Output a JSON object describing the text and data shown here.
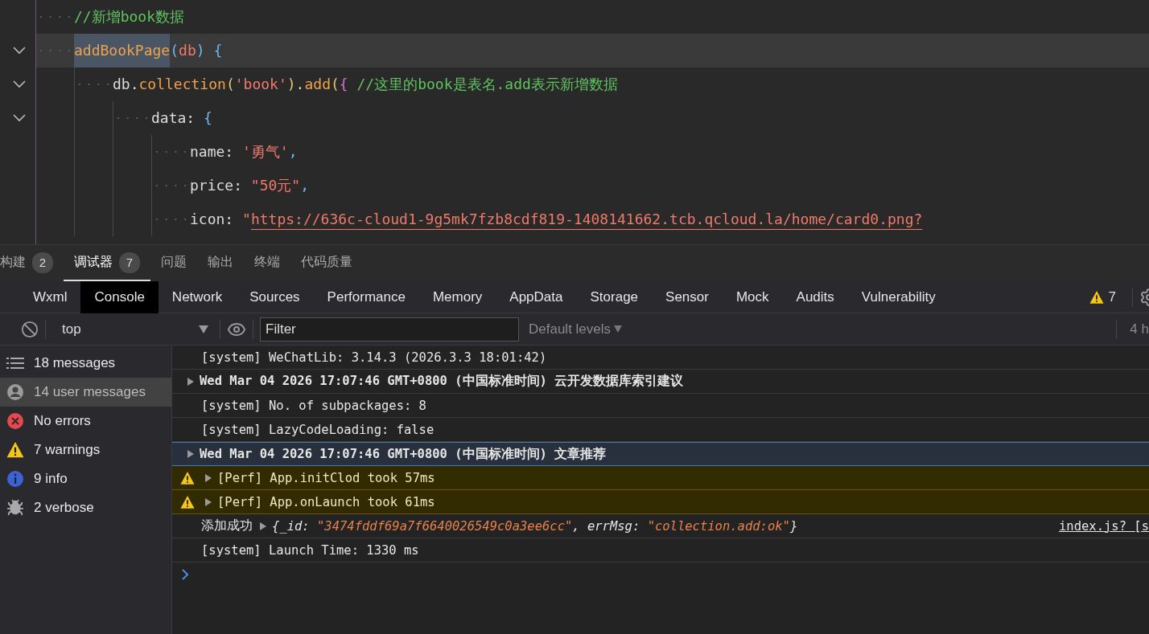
{
  "editor": {
    "lines": [
      {
        "current": false,
        "tokens": [
          {
            "kind": "comment",
            "text": "//新增book数据"
          }
        ]
      },
      {
        "current": true,
        "tokens": [
          {
            "kind": "function",
            "text": "addBookPage",
            "selected": true
          },
          {
            "kind": "brace",
            "text": "("
          },
          {
            "kind": "param",
            "text": "db"
          },
          {
            "kind": "brace",
            "text": ")"
          },
          {
            "kind": "brace",
            "text": " {"
          }
        ],
        "children": [
          {
            "current": false,
            "tokens": [
              {
                "kind": "plain",
                "text": "db."
              },
              {
                "kind": "function",
                "text": "collection"
              },
              {
                "kind": "paren",
                "text": "("
              },
              {
                "kind": "string",
                "text": "'book'"
              },
              {
                "kind": "paren",
                "text": ")"
              },
              {
                "kind": "plain",
                "text": "."
              },
              {
                "kind": "function",
                "text": "add"
              },
              {
                "kind": "paren",
                "text": "("
              },
              {
                "kind": "brace2",
                "text": "{"
              },
              {
                "kind": "comment",
                "text": " //这里的book是表名.add表示新增数据"
              }
            ],
            "children": [
              {
                "current": false,
                "tokens": [
                  {
                    "kind": "plain",
                    "text": "data: "
                  },
                  {
                    "kind": "brace",
                    "text": "{"
                  }
                ],
                "children": [
                  {
                    "current": false,
                    "tokens": [
                      {
                        "kind": "plain",
                        "text": "name: "
                      },
                      {
                        "kind": "string",
                        "text": "'勇气'"
                      },
                      {
                        "kind": "brace",
                        "text": ","
                      }
                    ]
                  },
                  {
                    "current": false,
                    "tokens": [
                      {
                        "kind": "plain",
                        "text": "price: "
                      },
                      {
                        "kind": "string",
                        "text": "\"50元\""
                      },
                      {
                        "kind": "brace",
                        "text": ","
                      }
                    ]
                  },
                  {
                    "current": false,
                    "tokens": [
                      {
                        "kind": "plain",
                        "text": "icon: "
                      },
                      {
                        "kind": "string",
                        "text": "\""
                      },
                      {
                        "kind": "url",
                        "text": "https://636c-cloud1-9g5mk7fzb8cdf819-1408141662.tcb.qcloud.la/home/card0.png?"
                      }
                    ]
                  }
                ]
              }
            ]
          }
        ]
      }
    ]
  },
  "bottom_tabs": [
    {
      "label": "构建",
      "badge": "2",
      "selected": false
    },
    {
      "label": "调试器",
      "badge": "7",
      "selected": true
    },
    {
      "label": "问题",
      "selected": false
    },
    {
      "label": "输出",
      "selected": false
    },
    {
      "label": "终端",
      "selected": false
    },
    {
      "label": "代码质量",
      "selected": false
    }
  ],
  "devtools_tabs": [
    {
      "label": "Wxml",
      "selected": false
    },
    {
      "label": "Console",
      "selected": true
    },
    {
      "label": "Network",
      "selected": false
    },
    {
      "label": "Sources",
      "selected": false
    },
    {
      "label": "Performance",
      "selected": false
    },
    {
      "label": "Memory",
      "selected": false
    },
    {
      "label": "AppData",
      "selected": false
    },
    {
      "label": "Storage",
      "selected": false
    },
    {
      "label": "Sensor",
      "selected": false
    },
    {
      "label": "Mock",
      "selected": false
    },
    {
      "label": "Audits",
      "selected": false
    },
    {
      "label": "Vulnerability",
      "selected": false
    }
  ],
  "warning_count": "7",
  "toolbar": {
    "context": "top",
    "filter_placeholder": "Filter",
    "levels": "Default levels",
    "hidden_count": "4 h"
  },
  "sidebar": {
    "items": [
      {
        "kind": "list",
        "label": "18 messages",
        "selected": false
      },
      {
        "kind": "user",
        "label": "14 user messages",
        "selected": true
      },
      {
        "kind": "error",
        "label": "No errors",
        "selected": false
      },
      {
        "kind": "warning",
        "label": "7 warnings",
        "selected": false
      },
      {
        "kind": "info",
        "label": "9 info",
        "selected": false
      },
      {
        "kind": "verbose",
        "label": "2 verbose",
        "selected": false
      }
    ]
  },
  "console": {
    "rows": [
      {
        "kind": "log",
        "text": "[system] WeChatLib: 3.14.3 (2026.3.3 18:01:42)",
        "selected": false
      },
      {
        "kind": "group",
        "text": "Wed Mar 04 2026 17:07:46 GMT+0800 (中国标准时间) 云开发数据库索引建议",
        "selected": false
      },
      {
        "kind": "log",
        "text": "[system] No. of subpackages: 8",
        "selected": false
      },
      {
        "kind": "log",
        "text": "[system] LazyCodeLoading: false",
        "selected": false
      },
      {
        "kind": "group",
        "text": "Wed Mar 04 2026 17:07:46 GMT+0800 (中国标准时间) 文章推荐",
        "selected": true
      },
      {
        "kind": "warning",
        "text": "[Perf] App.initClod took 57ms",
        "selected": false
      },
      {
        "kind": "warning",
        "text": "[Perf] App.onLaunch took 61ms",
        "selected": false
      },
      {
        "kind": "object",
        "text": "添加成功",
        "tokens": [
          {
            "kind": "punct",
            "text": "{"
          },
          {
            "kind": "key",
            "text": "_id: "
          },
          {
            "kind": "string",
            "text": "\"3474fddf69a7f6640026549c0a3ee6cc\""
          },
          {
            "kind": "key",
            "text": ", errMsg: "
          },
          {
            "kind": "string",
            "text": "\"collection.add:ok\""
          },
          {
            "kind": "punct",
            "text": "}"
          }
        ],
        "source": "index.js? [s",
        "selected": false
      },
      {
        "kind": "log",
        "text": "[system] Launch Time: 1330 ms",
        "selected": false
      }
    ]
  }
}
